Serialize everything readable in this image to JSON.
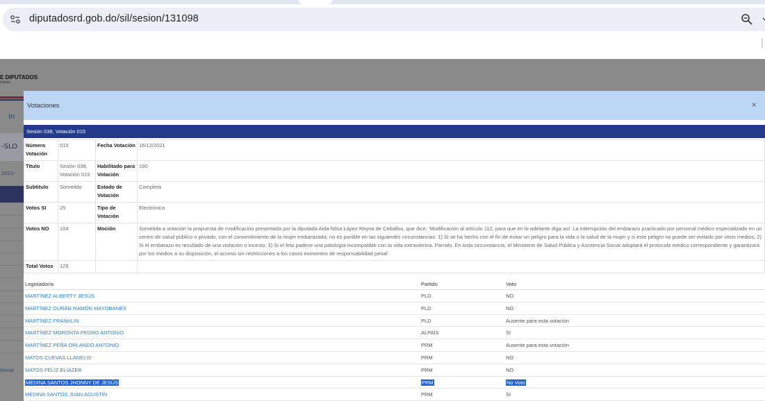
{
  "browser": {
    "url": "diputadosrd.gob.do/sil/sesion/131098",
    "icons": [
      "site-info-icon",
      "zoom-icon",
      "chevron-down-icon"
    ]
  },
  "background_page": {
    "brand": "E DIPUTADOS",
    "brand_sub": "inican",
    "nav_text": "In",
    "side_text": "-SLO",
    "year_text": "2021-",
    "history_text": "itorial"
  },
  "modal": {
    "title": "Votaciones",
    "close": "×",
    "session_title": "Sesión 038, Votación 015",
    "details": {
      "numero_label": "Número Votación",
      "numero_value": "015",
      "fecha_label": "Fecha Votación",
      "fecha_value": "16/12/2021",
      "titulo_label": "Titulo",
      "titulo_value": "Sesión 038, Votación 015",
      "habilitado_label": "Habilitado para Votación",
      "habilitado_value": "190",
      "subtitulo_label": "Subtitulo",
      "subtitulo_value": "Sometido",
      "estado_label": "Estado de Votación",
      "estado_value": "Completa",
      "si_label": "Votos SI",
      "si_value": "25",
      "tipo_label": "Tipo de Votación",
      "tipo_value": "Electrónica",
      "no_label": "Votos NO",
      "no_value": "104",
      "mocion_label": "Moción",
      "mocion_value": "Sometida a votación la propuesta de modificación presentada por la diputada Aida Nilsa López Reyna de Ceballos, que dice: 'Modificación al artículo 112, para que en lo adelante diga así: La interrupción del embarazo practicado por personal médico especializado en un centro de salud público o privado, con el consentimiento de la mujer embarazada, no es punible en las siguientes circunstancias: 1) Si se ha hecho con el fin de evitar un peligro para la vida o la salud de la mujer y si este peligro no puede ser evitado por otros medios; 2) Si el embarazo es resultado de una violación o incesto; 3) Si el feto padece una patología incompatible con la vida extrauterina. Párrafo. En toda circunstancia, el Ministerio de Salud Pública y Asistencia Social adoptará el protocolo médico correspondiente y garantizará por los medios a su disposición, el acceso sin restricciones a los casos eximentes de responsabilidad penal'.",
      "total_label": "Total Votos",
      "total_value": "129"
    },
    "list_headers": {
      "legislador": "Legislador/a",
      "partido": "Partido",
      "voto": "Voto"
    },
    "rows": [
      {
        "legislador": "MARTÍNEZ ALBERTY JESÚS",
        "partido": "PLD",
        "voto": "NO"
      },
      {
        "legislador": "MARTÍNEZ DURÁN RAMÓN MAYOBANEX",
        "partido": "PLD",
        "voto": "NO"
      },
      {
        "legislador": "MARTÍNEZ FRANKLIN",
        "partido": "PLD",
        "voto": "Ausente para esta votación"
      },
      {
        "legislador": "MARTÍNEZ MORONTA PEDRO ANTONIO",
        "partido": "ALPAÍS",
        "voto": "SI"
      },
      {
        "legislador": "MARTÍNEZ PEÑA ORLANDO ANTONIO",
        "partido": "PRM",
        "voto": "Ausente para esta votación"
      },
      {
        "legislador": "MATOS CUEVAS LLANELIS",
        "partido": "PRM",
        "voto": "NO"
      },
      {
        "legislador": "MATOS FÉLIZ ELIAZER",
        "partido": "PRM",
        "voto": "NO"
      },
      {
        "legislador": "MEDINA SANTOS JHONNY DE JESÚS",
        "partido": "PRM",
        "voto": "No Voto"
      },
      {
        "legislador": "MEDINA SANTOS JUAN AGUSTÍN",
        "partido": "PRM",
        "voto": "SI"
      }
    ],
    "selected_row_index": 7
  }
}
